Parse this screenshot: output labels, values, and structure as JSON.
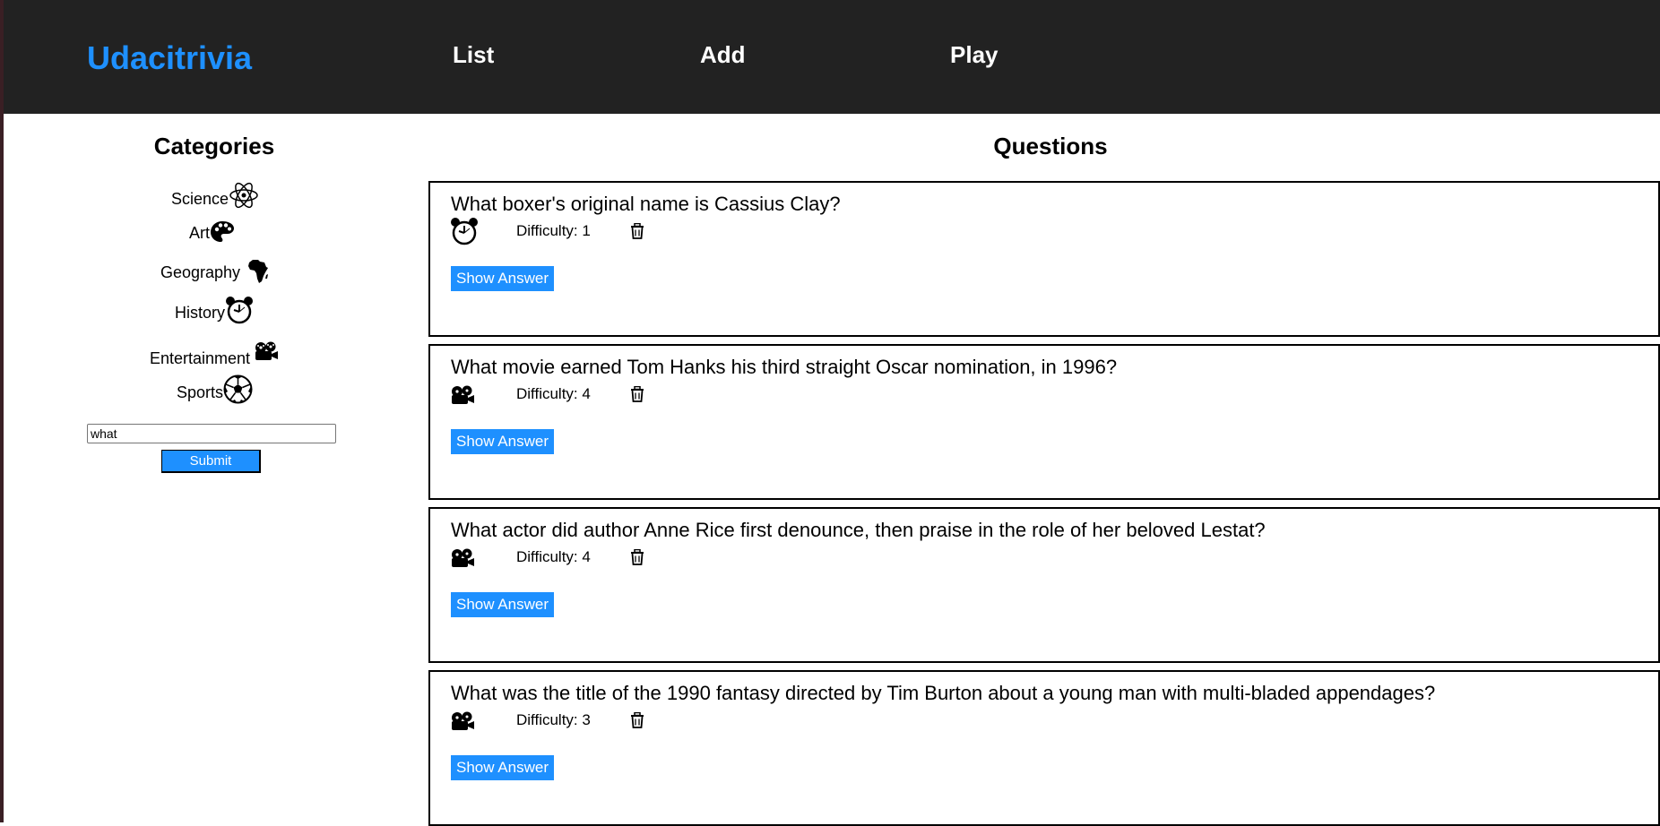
{
  "header": {
    "logo": "Udacitrivia",
    "nav": {
      "list": "List",
      "add": "Add",
      "play": "Play"
    }
  },
  "sidebar": {
    "title": "Categories",
    "categories": [
      {
        "label": "Science",
        "icon": "atom-icon"
      },
      {
        "label": "Art",
        "icon": "palette-icon"
      },
      {
        "label": "Geography",
        "icon": "africa-map-icon"
      },
      {
        "label": "History",
        "icon": "alarm-clock-icon"
      },
      {
        "label": "Entertainment",
        "icon": "film-camera-icon"
      },
      {
        "label": "Sports",
        "icon": "soccer-ball-icon"
      }
    ],
    "search": {
      "value": "what",
      "placeholder": ""
    },
    "submit_label": "Submit"
  },
  "main": {
    "title": "Questions",
    "questions": [
      {
        "text": "What boxer's original name is Cassius Clay?",
        "difficulty": "Difficulty: 1",
        "category_icon": "alarm-clock-icon",
        "show_answer": "Show Answer"
      },
      {
        "text": "What movie earned Tom Hanks his third straight Oscar nomination, in 1996?",
        "difficulty": "Difficulty: 4",
        "category_icon": "film-camera-icon",
        "show_answer": "Show Answer"
      },
      {
        "text": "What actor did author Anne Rice first denounce, then praise in the role of her beloved Lestat?",
        "difficulty": "Difficulty: 4",
        "category_icon": "film-camera-icon",
        "show_answer": "Show Answer"
      },
      {
        "text": "What was the title of the 1990 fantasy directed by Tim Burton about a young man with multi-bladed appendages?",
        "difficulty": "Difficulty: 3",
        "category_icon": "film-camera-icon",
        "show_answer": "Show Answer"
      }
    ]
  },
  "colors": {
    "header_bg": "#222222",
    "accent": "#1e90ff"
  }
}
